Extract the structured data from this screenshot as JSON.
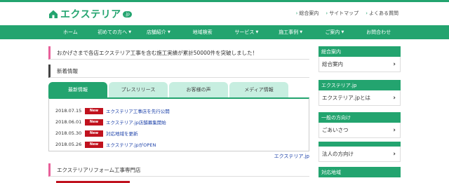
{
  "logo": {
    "text": "エクステリア",
    "badge": ".jp",
    "icon": "house-icon"
  },
  "top_links": [
    {
      "label": "総合案内"
    },
    {
      "label": "サイトマップ"
    },
    {
      "label": "よくある質問"
    }
  ],
  "nav": [
    {
      "label": "ホーム",
      "caret": false
    },
    {
      "label": "初めての方へ",
      "caret": true
    },
    {
      "label": "店舗紹介",
      "caret": true
    },
    {
      "label": "地域検索",
      "caret": false
    },
    {
      "label": "サービス",
      "caret": true
    },
    {
      "label": "施工事例",
      "caret": true
    },
    {
      "label": "ご案内",
      "caret": true
    },
    {
      "label": "お問合わせ",
      "caret": false
    }
  ],
  "announcement": "おかげさまで各店エクステリア工事を含む施工実績が累計50000件を突破しました！",
  "news": {
    "heading": "新着情報",
    "tabs": [
      "最新情報",
      "プレスリリース",
      "お客様の声",
      "メディア情報"
    ],
    "items": [
      {
        "date": "2018.07.15",
        "badge": "New",
        "text": "エクステリア工事店を先行公開"
      },
      {
        "date": "2018.06.01",
        "badge": "New",
        "text": "エクステリア.jp店舗募集開始"
      },
      {
        "date": "2018.05.30",
        "badge": "New",
        "text": "対応地域を更新"
      },
      {
        "date": "2018.05.26",
        "badge": "New",
        "text": "エクステリア.jpがOPEN"
      }
    ],
    "more": "エクステリア.jp"
  },
  "section2": {
    "heading": "エクステリアリフォーム工事専門店"
  },
  "sidebar": {
    "blocks": [
      {
        "head": "総合案内",
        "item": "総合案内"
      },
      {
        "head": "エクステリア.jp",
        "item": "エクステリア.jpとは"
      },
      {
        "head": "一般の方向け",
        "item": "ごあいさつ"
      },
      {
        "head": "",
        "item": "法人の方向け"
      }
    ],
    "last_head": "対応地域"
  },
  "colors": {
    "brand": "#23a46f",
    "tab_inactive": "#c7eee0",
    "new_badge": "#c0121e",
    "accent_pink": "#e8609a",
    "link": "#1a3fa8"
  }
}
